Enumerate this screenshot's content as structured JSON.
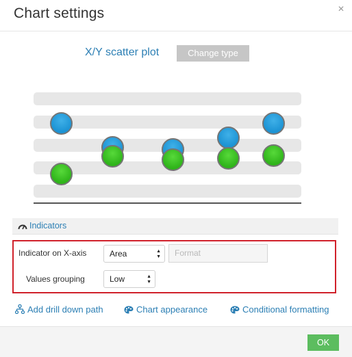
{
  "dialog": {
    "title": "Chart settings"
  },
  "chart": {
    "type_label": "X/Y scatter plot",
    "change_type_label": "Change type"
  },
  "indicators": {
    "header": "Indicators",
    "x_axis_label": "Indicator on X-axis",
    "x_axis_value": "Area",
    "format_placeholder": "Format",
    "grouping_label": "Values grouping",
    "grouping_value": "Low"
  },
  "links": {
    "drill_down": "Add drill down path",
    "appearance": "Chart appearance",
    "conditional": "Conditional formatting"
  },
  "footer": {
    "ok_label": "OK"
  },
  "colors": {
    "accent": "#2c7fb4",
    "ok": "#5cbd5f",
    "highlight": "#d0202a"
  }
}
